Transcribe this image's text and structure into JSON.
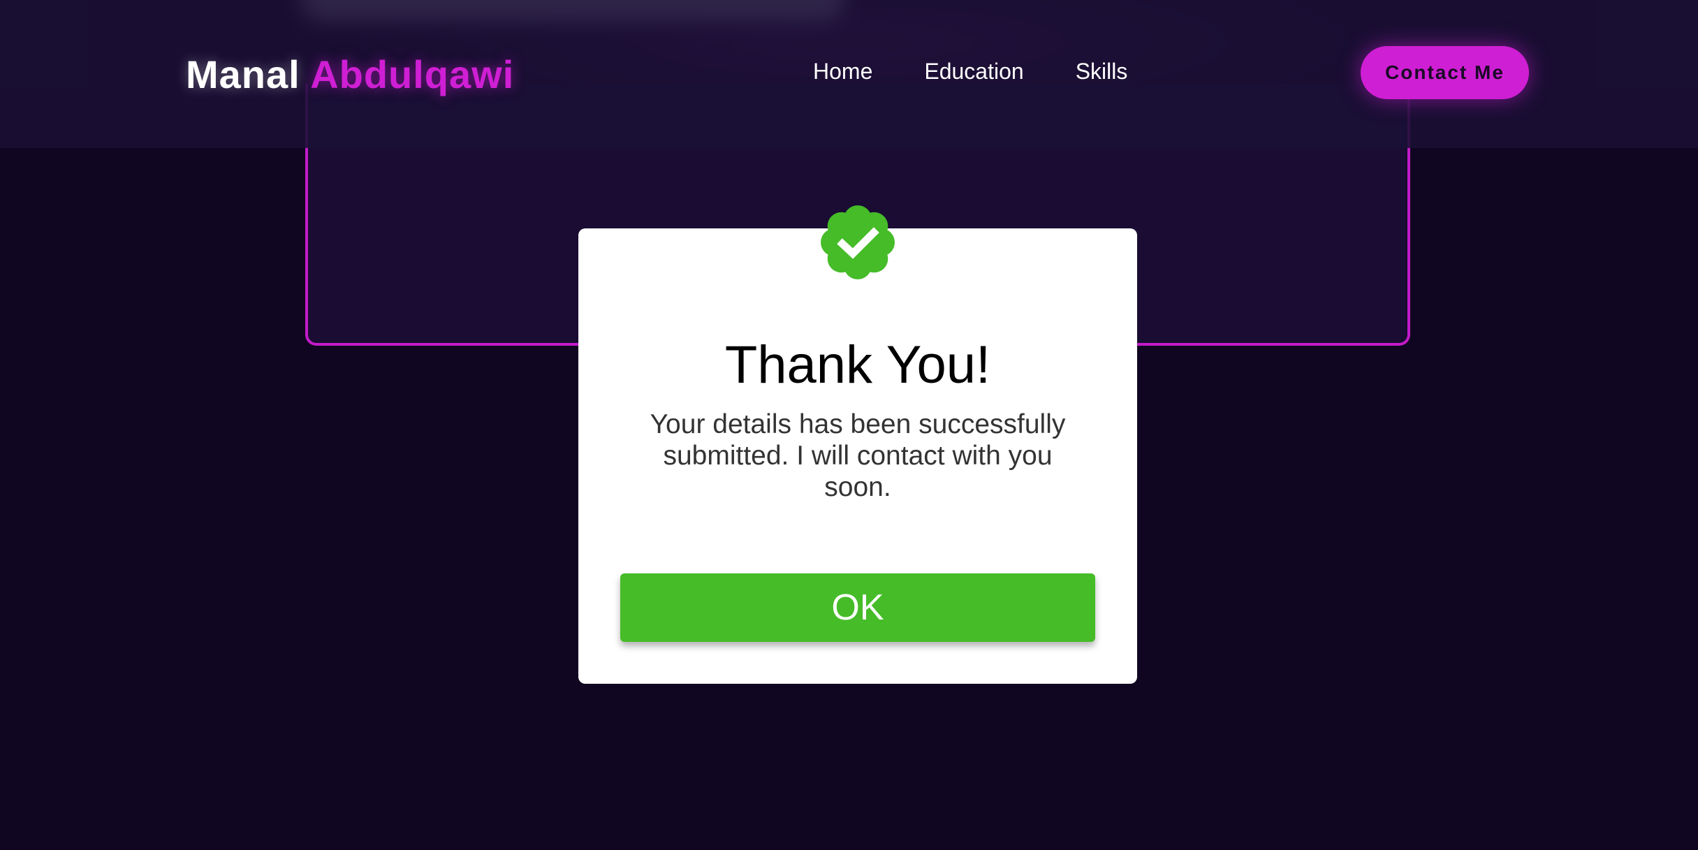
{
  "header": {
    "logo_first": "Manal",
    "logo_last": "Abdulqawi",
    "nav": [
      "Home",
      "Education",
      "Skills"
    ],
    "contact_label": "Contact Me"
  },
  "modal": {
    "icon": "check-badge-icon",
    "title": "Thank You!",
    "message": "Your details has been successfully submitted. I will contact with you soon.",
    "ok_label": "OK"
  },
  "colors": {
    "background": "#110621",
    "accent": "#cf1fd4",
    "success": "#45bc28"
  }
}
